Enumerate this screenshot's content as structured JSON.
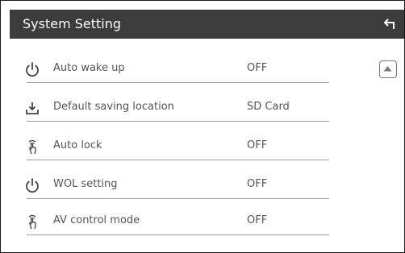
{
  "header": {
    "title": "System Setting"
  },
  "settings": [
    {
      "label": "Auto wake up",
      "value": "OFF",
      "icon": "power-icon"
    },
    {
      "label": "Default saving location",
      "value": "SD Card",
      "icon": "download-icon"
    },
    {
      "label": "Auto lock",
      "value": "OFF",
      "icon": "touch-wave-icon"
    },
    {
      "label": "WOL setting",
      "value": "OFF",
      "icon": "power-icon"
    },
    {
      "label": "AV control mode",
      "value": "OFF",
      "icon": "touch-wave-icon"
    }
  ],
  "colors": {
    "header": "#3c3c3c",
    "text": "#555555",
    "divider": "#9c9c9c"
  }
}
